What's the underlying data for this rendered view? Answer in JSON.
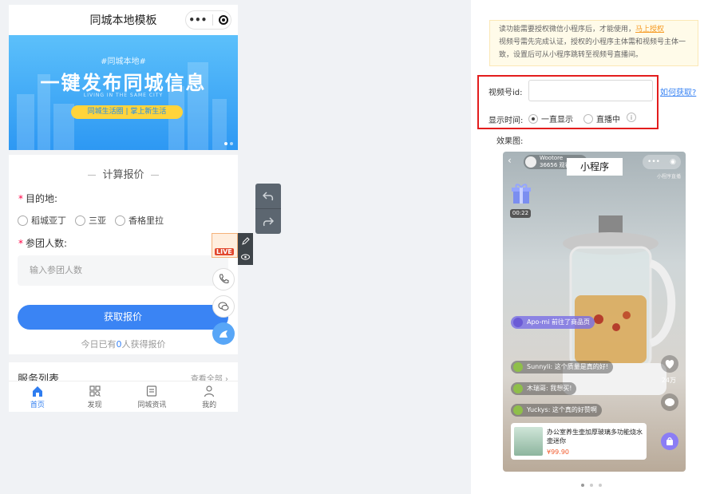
{
  "phone": {
    "title": "同城本地模板",
    "capsule_more": "•••",
    "banner": {
      "sub": "#同城本地#",
      "main": "一键发布同城信息",
      "en": "LIVING IN THE SAME CITY",
      "pill": "同城生活圈 | 掌上新生活"
    },
    "quote": {
      "title": "计算报价",
      "dest_label": "目的地:",
      "dest_options": [
        "稻城亚丁",
        "三亚",
        "香格里拉"
      ],
      "people_label": "参团人数:",
      "people_placeholder": "输入参团人数",
      "submit": "获取报价",
      "today_prefix": "今日已有",
      "today_count": "0",
      "today_suffix": "人获得报价"
    },
    "services": {
      "title": "服务列表",
      "view_all": "查看全部"
    },
    "tabs": [
      "首页",
      "发现",
      "同城资讯",
      "我的"
    ],
    "live_badge": "LIVE"
  },
  "panel": {
    "notice_prefix": "读功能需要授权微信小程序后，才能使用，",
    "notice_link": "马上授权",
    "notice_rest": "视频号需先完成认证，授权的小程序主体需和视频号主体一致，设置后可从小程序跳转至视频号直播间。",
    "video_id_label": "视频号id:",
    "video_id_value": "",
    "howto_link": "如何获取?",
    "show_time_label": "显示时间:",
    "show_options": [
      "一直显示",
      "直播中"
    ],
    "show_selected": "一直显示",
    "effect_label": "效果图:"
  },
  "preview": {
    "mini_program": "小程序",
    "account_name": "Wootore",
    "account_meta": "36656 观看",
    "sub_tag": "小程序直播",
    "time": "00:22",
    "comments": [
      "Apo-mi 前往了商品页",
      "Sunnyli: 这个质量是真的好!",
      "木瑞哥: 我想买!",
      "Yuckys: 这个真的好赞啊"
    ],
    "likes": "24万",
    "product_name": "办公室养生壶加厚玻璃多功能烧水壶迷你",
    "product_price": "¥99.90"
  }
}
